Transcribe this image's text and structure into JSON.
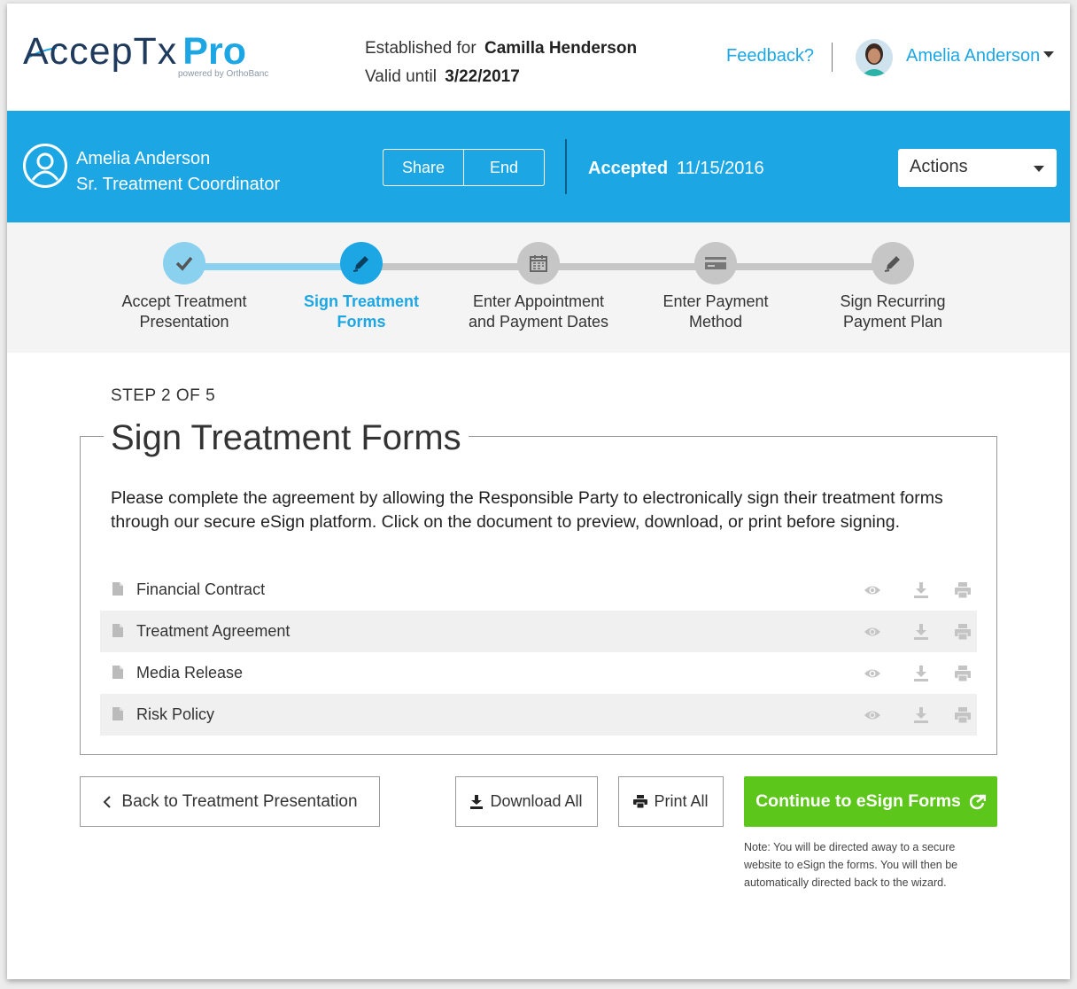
{
  "header": {
    "logo_main": "AccepTx",
    "logo_pro": "Pro",
    "logo_sub": "powered by OrthoBanc",
    "established_prefix": "Established for",
    "established_name": "Camilla Henderson",
    "valid_prefix": "Valid until",
    "valid_date": "3/22/2017",
    "feedback": "Feedback?",
    "user_name": "Amelia Anderson"
  },
  "bluebar": {
    "name": "Amelia Anderson",
    "role": "Sr. Treatment Coordinator",
    "share_label": "Share",
    "end_label": "End",
    "status_label": "Accepted",
    "status_date": "11/15/2016",
    "actions_label": "Actions"
  },
  "steps": [
    {
      "line1": "Accept Treatment",
      "line2": "Presentation",
      "icon": "check-icon",
      "state": "done"
    },
    {
      "line1": "Sign Treatment",
      "line2": "Forms",
      "icon": "pen-icon",
      "state": "active"
    },
    {
      "line1": "Enter Appointment",
      "line2": "and Payment Dates",
      "icon": "calendar-icon",
      "state": "todo"
    },
    {
      "line1": "Enter Payment",
      "line2": "Method",
      "icon": "credit-card-icon",
      "state": "todo"
    },
    {
      "line1": "Sign Recurring",
      "line2": "Payment Plan",
      "icon": "pen-icon",
      "state": "todo"
    }
  ],
  "main": {
    "step_count": "STEP 2 OF 5",
    "title": "Sign Treatment Forms",
    "intro": "Please complete the agreement by allowing the Responsible Party to electronically sign their treatment forms through our secure eSign platform. Click on the document to preview, download, or print before signing.",
    "documents": [
      {
        "name": "Financial Contract"
      },
      {
        "name": "Treatment Agreement"
      },
      {
        "name": "Media Release"
      },
      {
        "name": "Risk Policy"
      }
    ]
  },
  "buttons": {
    "back": "Back to Treatment Presentation",
    "download_all": "Download All",
    "print_all": "Print All",
    "continue": "Continue to eSign Forms",
    "note": "Note: You will be directed away to a secure website to eSign the forms. You will then be automatically directed back to the wizard."
  },
  "colors": {
    "brand_blue": "#1ca6e4",
    "success_green": "#5cc71a",
    "done_step": "#8ad0ef",
    "todo_step": "#c6c6c6"
  }
}
